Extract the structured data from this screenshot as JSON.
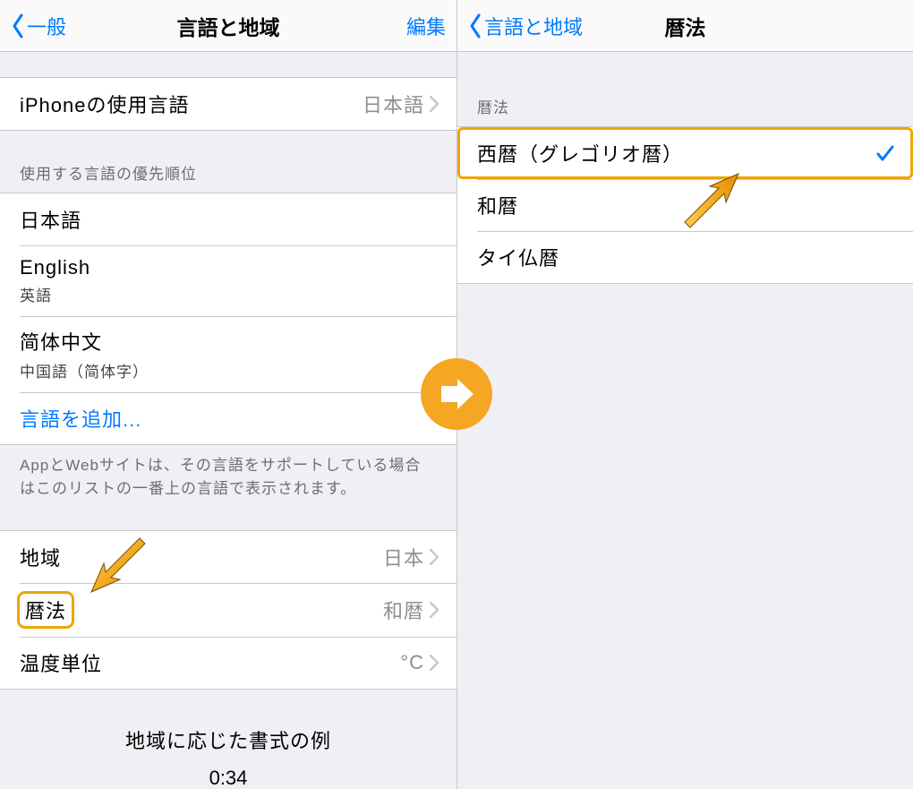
{
  "left": {
    "nav": {
      "back": "一般",
      "title": "言語と地域",
      "edit": "編集"
    },
    "row_lang": {
      "label": "iPhoneの使用言語",
      "value": "日本語"
    },
    "sect_pref": {
      "header": "使用する言語の優先順位"
    },
    "lang_items": [
      {
        "label": "日本語",
        "sub": ""
      },
      {
        "label": "English",
        "sub": "英語"
      },
      {
        "label": "简体中文",
        "sub": "中国語（简体字）"
      }
    ],
    "add_lang": {
      "label": "言語を追加..."
    },
    "pref_footer": "AppとWebサイトは、その言語をサポートしている場合はこのリストの一番上の言語で表示されます。",
    "row_region": {
      "label": "地域",
      "value": "日本"
    },
    "row_calendar": {
      "label": "暦法",
      "value": "和暦"
    },
    "row_temp": {
      "label": "温度単位",
      "value": "°C"
    },
    "example": {
      "title": "地域に応じた書式の例",
      "time": "0:34"
    }
  },
  "right": {
    "nav": {
      "back": "言語と地域",
      "title": "暦法"
    },
    "sect_header": "暦法",
    "options": [
      {
        "label": "西暦（グレゴリオ暦）",
        "selected": true
      },
      {
        "label": "和暦",
        "selected": false
      },
      {
        "label": "タイ仏暦",
        "selected": false
      }
    ]
  }
}
